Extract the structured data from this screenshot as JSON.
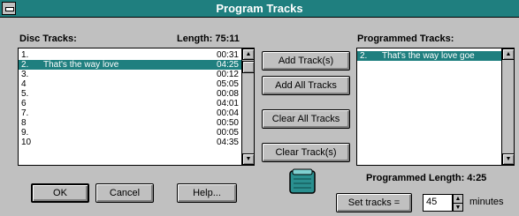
{
  "window": {
    "title": "Program Tracks"
  },
  "disc_tracks": {
    "label": "Disc Tracks:",
    "length_label": "Length: 75:11",
    "tracks": [
      {
        "num": "1.",
        "name": "",
        "time": "00:31"
      },
      {
        "num": "2.",
        "name": "That's the way love",
        "time": "04:25"
      },
      {
        "num": "3.",
        "name": "",
        "time": "00:12"
      },
      {
        "num": "4",
        "name": "",
        "time": "05:05"
      },
      {
        "num": "5.",
        "name": "",
        "time": "00:08"
      },
      {
        "num": "6",
        "name": "",
        "time": "04:01"
      },
      {
        "num": "7.",
        "name": "",
        "time": "00:04"
      },
      {
        "num": "8",
        "name": "",
        "time": "00:50"
      },
      {
        "num": "9.",
        "name": "",
        "time": "00:05"
      },
      {
        "num": "10",
        "name": "",
        "time": "04:35"
      }
    ]
  },
  "buttons": {
    "add_tracks": "Add Track(s)",
    "add_all_tracks": "Add All Tracks",
    "clear_all_tracks": "Clear All Tracks",
    "clear_tracks": "Clear Track(s)",
    "ok": "OK",
    "cancel": "Cancel",
    "help": "Help...",
    "set_tracks": "Set tracks ="
  },
  "programmed": {
    "label": "Programmed Tracks:",
    "tracks": [
      {
        "num": "2.",
        "name": "That's the way love goe"
      }
    ],
    "length_label": "Programmed Length: 4:25"
  },
  "set_tracks": {
    "value": "45",
    "unit": "minutes"
  },
  "icons": {
    "disc": "cd-case-icon"
  },
  "colors": {
    "accent": "#1f7f7f",
    "face": "#c0c0c0"
  }
}
